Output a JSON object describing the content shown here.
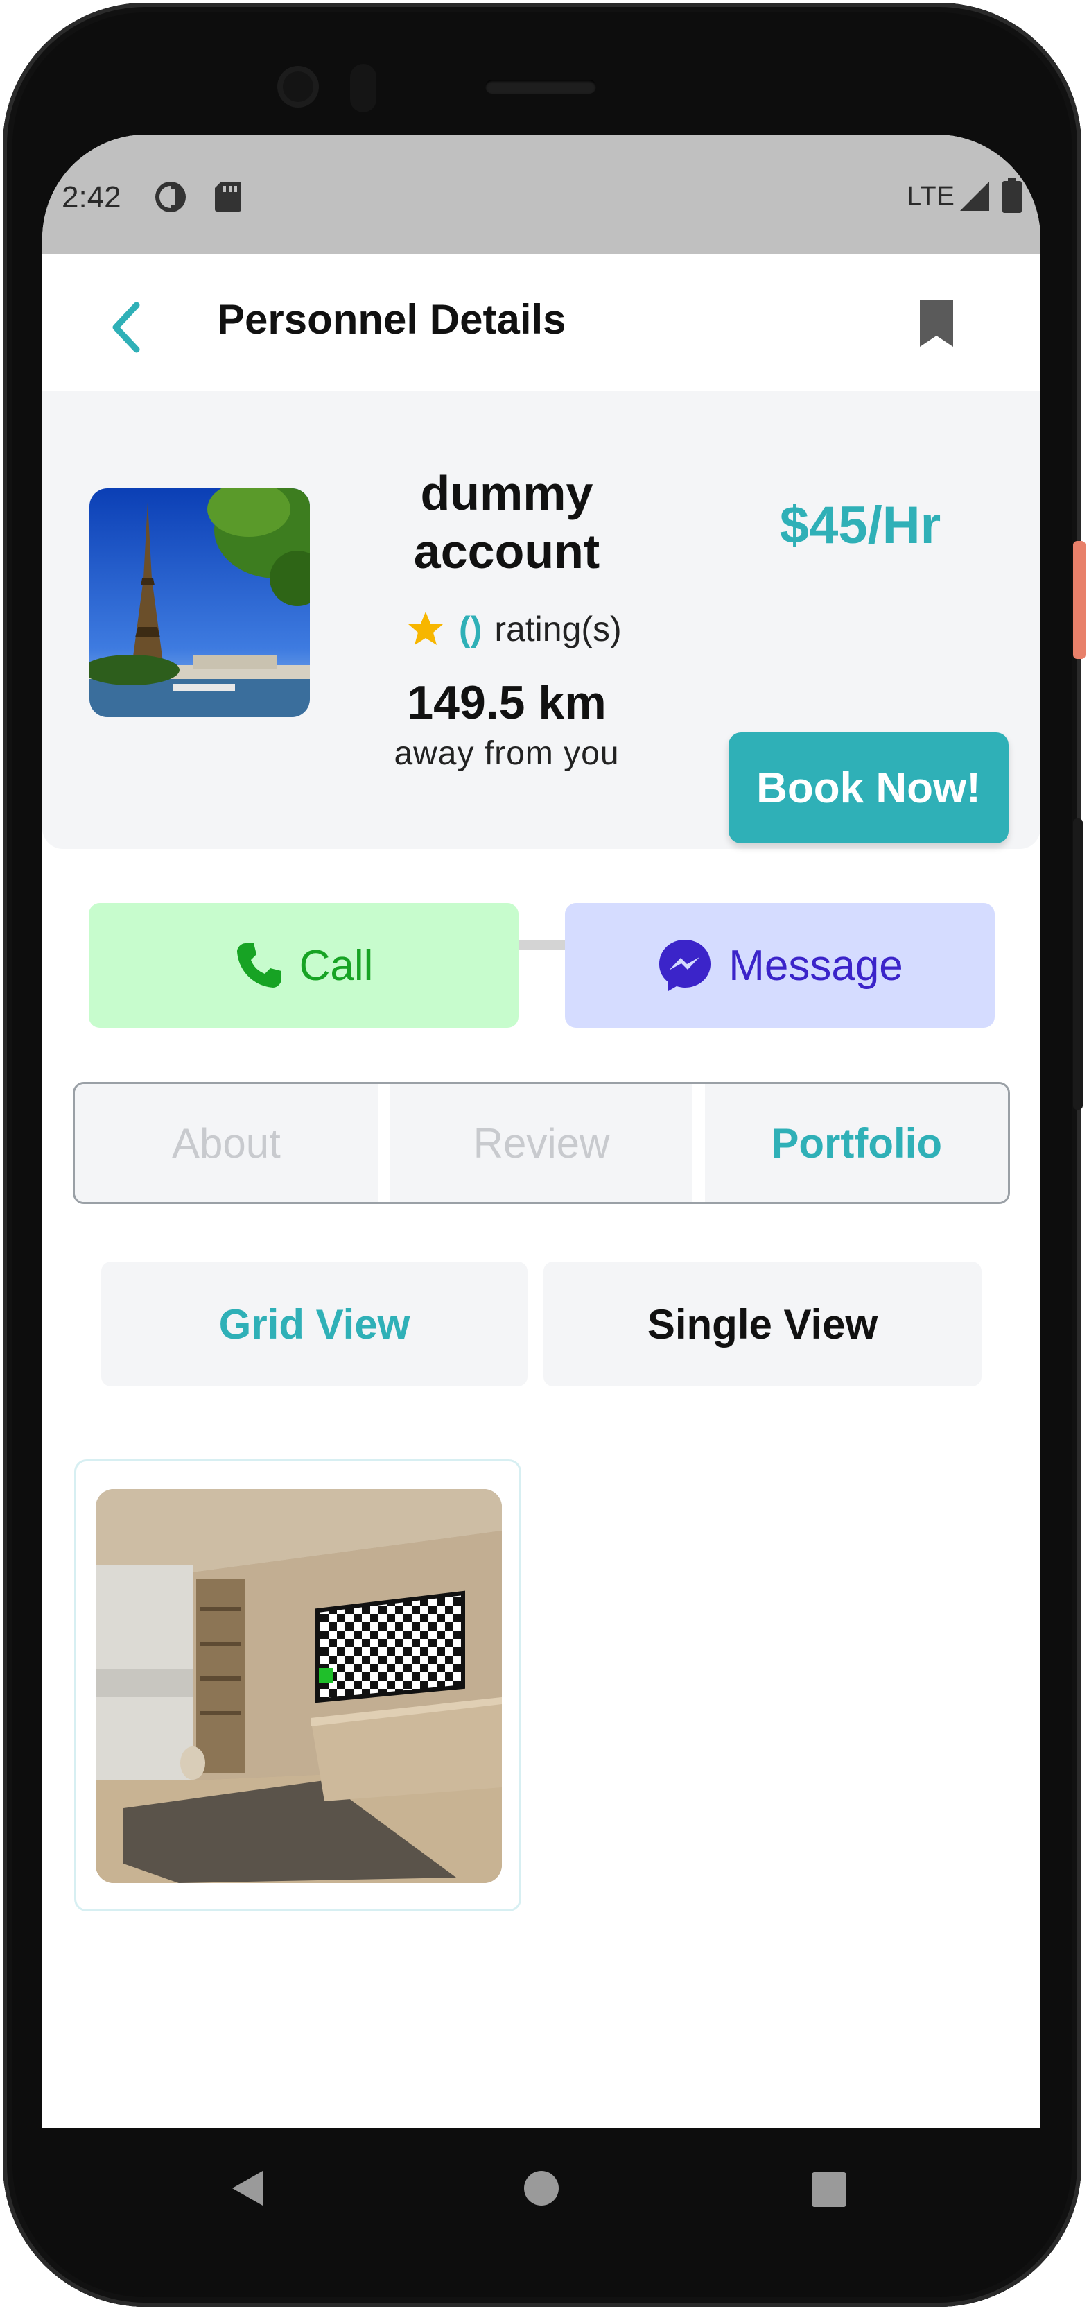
{
  "status_bar": {
    "time": "2:42",
    "network": "LTE",
    "icons": [
      "notification-icon",
      "sd-card-icon",
      "signal-icon",
      "battery-icon"
    ]
  },
  "app_bar": {
    "title": "Personnel Details",
    "back_icon": "chevron-left-icon",
    "bookmark_icon": "bookmark-icon"
  },
  "profile": {
    "name": "dummy account",
    "rating_value": "()",
    "rating_label": "rating(s)",
    "distance": "149.5 km",
    "distance_label": "away from you",
    "price": "$45/Hr",
    "book_label": "Book Now!"
  },
  "actions": {
    "call_label": "Call",
    "message_label": "Message"
  },
  "tabs": [
    {
      "label": "About",
      "active": false
    },
    {
      "label": "Review",
      "active": false
    },
    {
      "label": "Portfolio",
      "active": true
    }
  ],
  "view_toggle": {
    "grid_label": "Grid View",
    "single_label": "Single View",
    "selected": "Grid View"
  },
  "colors": {
    "accent": "#2fb0b7",
    "call_bg": "#c7fccd",
    "call_fg": "#17a324",
    "message_bg": "#d5dcff",
    "message_fg": "#3b24c9",
    "card_bg": "#f4f5f7"
  }
}
